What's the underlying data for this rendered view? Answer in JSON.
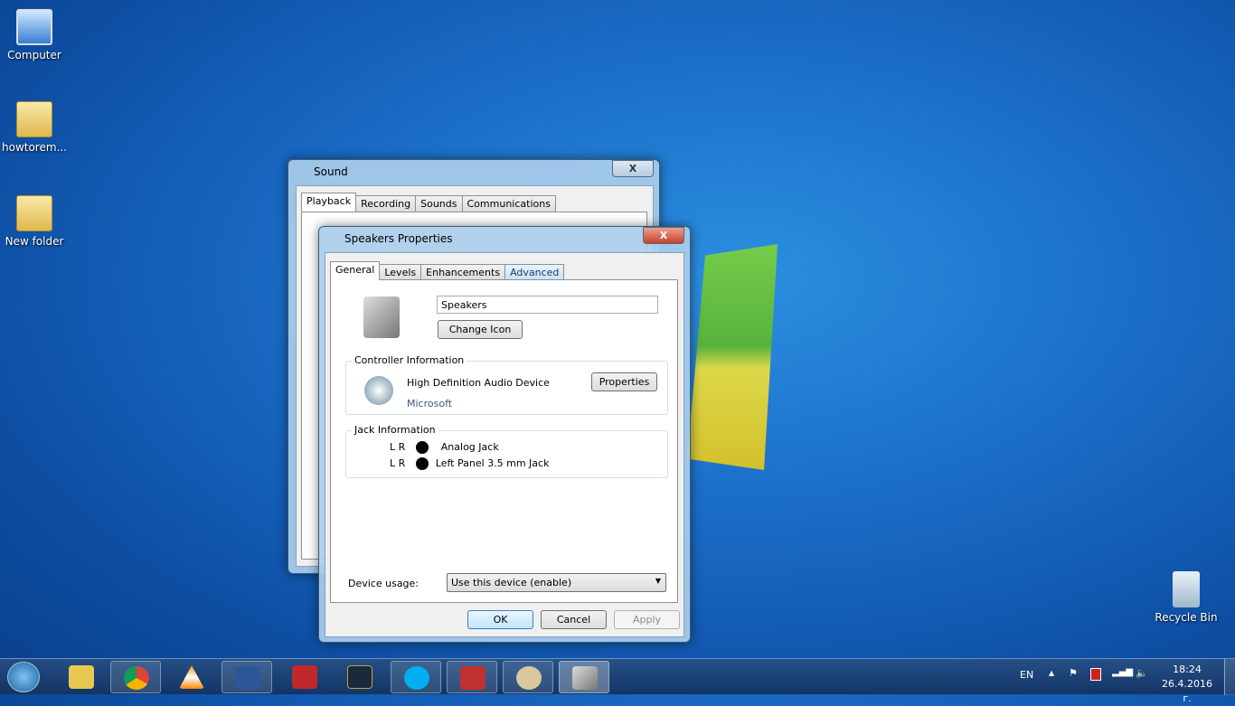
{
  "desktop": {
    "icons": [
      {
        "label": "Computer"
      },
      {
        "label": "howtorem..."
      },
      {
        "label": "New folder"
      },
      {
        "label": "Recycle Bin"
      }
    ]
  },
  "sound": {
    "title": "Sound",
    "close": "X",
    "tabs": [
      "Playback",
      "Recording",
      "Sounds",
      "Communications"
    ]
  },
  "props": {
    "title": "Speakers Properties",
    "close": "X",
    "tabs": [
      "General",
      "Levels",
      "Enhancements",
      "Advanced"
    ],
    "name_value": "Speakers",
    "change_icon": "Change Icon",
    "controller": {
      "label": "Controller Information",
      "device": "High Definition Audio Device",
      "vendor": "Microsoft",
      "properties": "Properties"
    },
    "jack": {
      "label": "Jack Information",
      "rows": [
        {
          "channels": "L R",
          "name": "Analog Jack"
        },
        {
          "channels": "L R",
          "name": "Left Panel 3.5 mm Jack"
        }
      ]
    },
    "usage_label": "Device usage:",
    "usage_value": "Use this device (enable)",
    "ok": "OK",
    "cancel": "Cancel",
    "apply": "Apply"
  },
  "taskbar": {
    "apps": [
      "start",
      "explorer",
      "chrome",
      "vlc",
      "word",
      "ccleaner",
      "league-of-legends",
      "skype",
      "toolbox",
      "paint",
      "sound"
    ],
    "lang": "EN",
    "time": "18:24",
    "date": "26.4.2016 г."
  }
}
